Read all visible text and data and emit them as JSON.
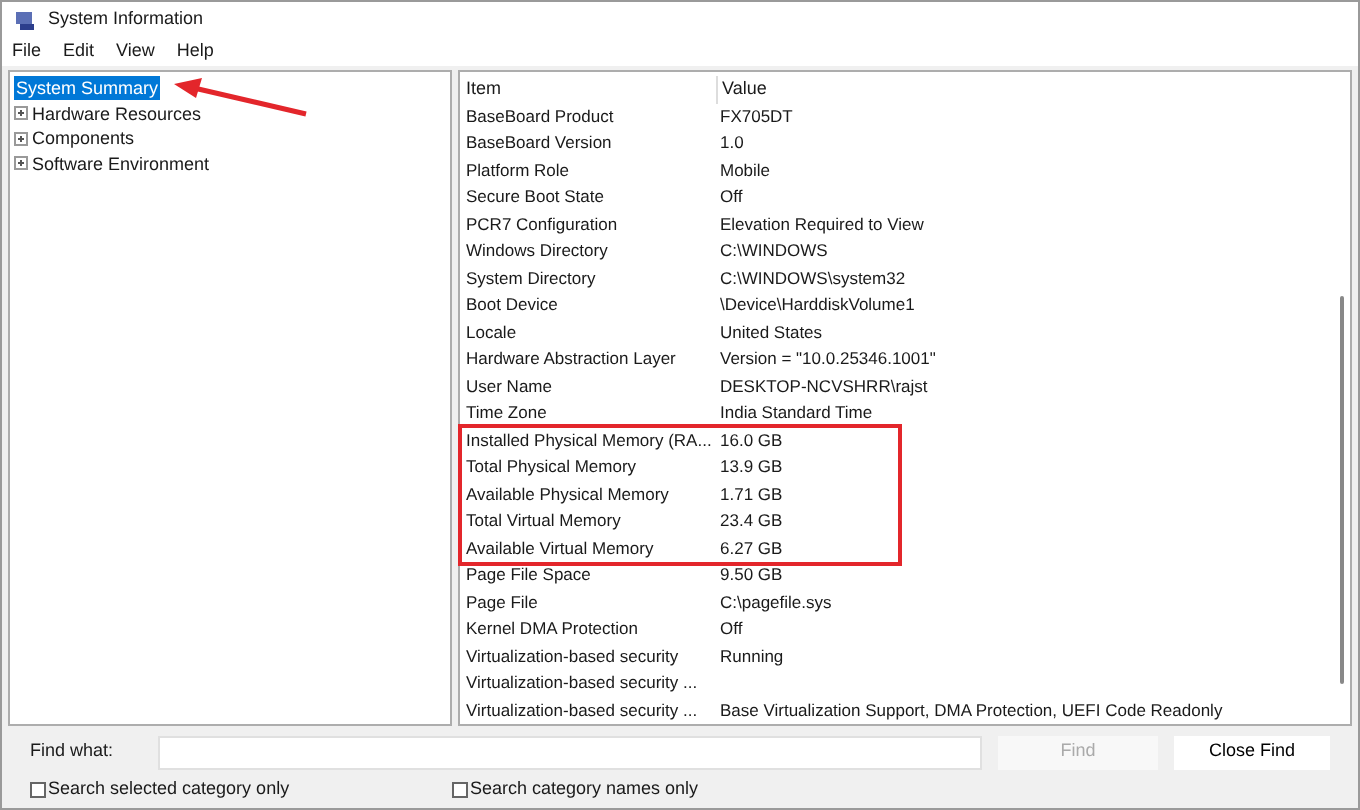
{
  "window": {
    "title": "System Information"
  },
  "menu": [
    "File",
    "Edit",
    "View",
    "Help"
  ],
  "tree": [
    {
      "label": "System Summary",
      "selected": true,
      "expandable": false,
      "pointed": true
    },
    {
      "label": "Hardware Resources",
      "selected": false,
      "expandable": true,
      "pointed": false
    },
    {
      "label": "Components",
      "selected": false,
      "expandable": true,
      "pointed": false
    },
    {
      "label": "Software Environment",
      "selected": false,
      "expandable": true,
      "pointed": false
    }
  ],
  "table": {
    "columns": [
      "Item",
      "Value"
    ],
    "rows": [
      {
        "item": "BaseBoard Product",
        "value": "FX705DT",
        "highlighted": false
      },
      {
        "item": "BaseBoard Version",
        "value": "1.0",
        "highlighted": false
      },
      {
        "item": "Platform Role",
        "value": "Mobile",
        "highlighted": false
      },
      {
        "item": "Secure Boot State",
        "value": "Off",
        "highlighted": false
      },
      {
        "item": "PCR7 Configuration",
        "value": "Elevation Required to View",
        "highlighted": false
      },
      {
        "item": "Windows Directory",
        "value": "C:\\WINDOWS",
        "highlighted": false
      },
      {
        "item": "System Directory",
        "value": "C:\\WINDOWS\\system32",
        "highlighted": false
      },
      {
        "item": "Boot Device",
        "value": "\\Device\\HarddiskVolume1",
        "highlighted": false
      },
      {
        "item": "Locale",
        "value": "United States",
        "highlighted": false
      },
      {
        "item": "Hardware Abstraction Layer",
        "value": "Version = \"10.0.25346.1001\"",
        "highlighted": false
      },
      {
        "item": "User Name",
        "value": "DESKTOP-NCVSHRR\\rajst",
        "highlighted": false
      },
      {
        "item": "Time Zone",
        "value": "India Standard Time",
        "highlighted": false
      },
      {
        "item": "Installed Physical Memory (RA...",
        "value": "16.0 GB",
        "highlighted": true
      },
      {
        "item": "Total Physical Memory",
        "value": "13.9 GB",
        "highlighted": true
      },
      {
        "item": "Available Physical Memory",
        "value": "1.71 GB",
        "highlighted": true
      },
      {
        "item": "Total Virtual Memory",
        "value": "23.4 GB",
        "highlighted": true
      },
      {
        "item": "Available Virtual Memory",
        "value": "6.27 GB",
        "highlighted": true
      },
      {
        "item": "Page File Space",
        "value": "9.50 GB",
        "highlighted": false
      },
      {
        "item": "Page File",
        "value": "C:\\pagefile.sys",
        "highlighted": false
      },
      {
        "item": "Kernel DMA Protection",
        "value": "Off",
        "highlighted": false
      },
      {
        "item": "Virtualization-based security",
        "value": "Running",
        "highlighted": false
      },
      {
        "item": "Virtualization-based security ...",
        "value": "",
        "highlighted": false
      },
      {
        "item": "Virtualization-based security ...",
        "value": "Base Virtualization Support, DMA Protection, UEFI Code Readonly",
        "highlighted": false
      }
    ]
  },
  "find": {
    "label": "Find what:",
    "find_button": {
      "label": "Find",
      "disabled": true
    },
    "close_button": {
      "label": "Close Find",
      "disabled": false
    }
  },
  "options": [
    {
      "label": "Search selected category only",
      "checked": false
    },
    {
      "label": "Search category names only",
      "checked": false
    }
  ]
}
